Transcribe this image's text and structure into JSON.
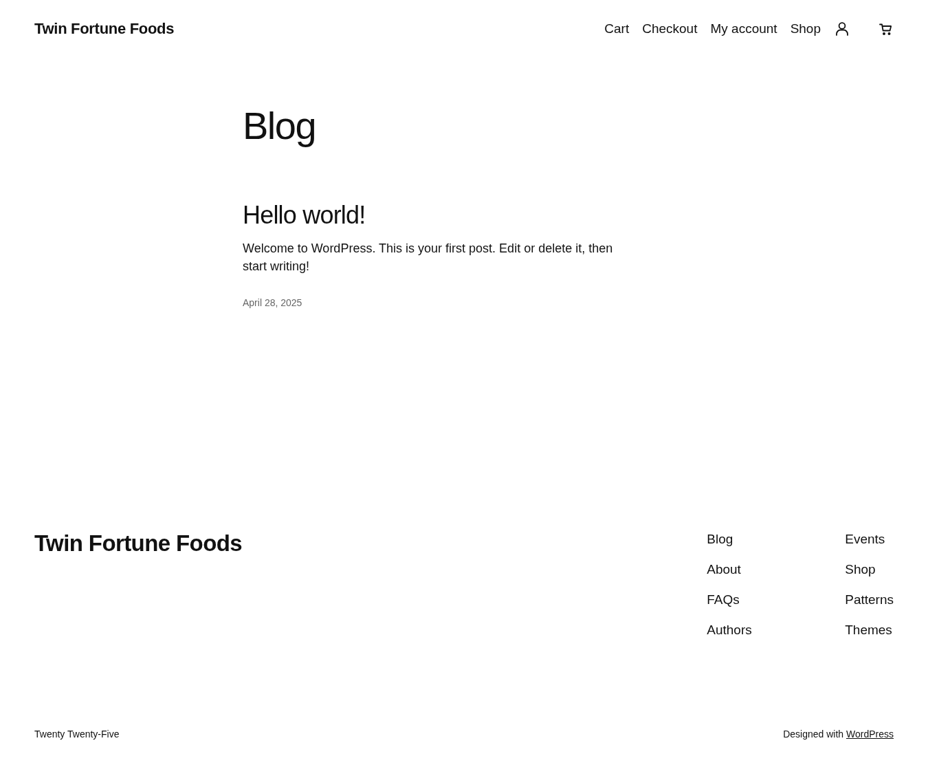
{
  "header": {
    "site_title": "Twin Fortune Foods",
    "nav": [
      {
        "label": "Cart"
      },
      {
        "label": "Checkout"
      },
      {
        "label": "My account"
      },
      {
        "label": "Shop"
      }
    ]
  },
  "page_title": "Blog",
  "posts": [
    {
      "title": "Hello world!",
      "excerpt": "Welcome to WordPress. This is your first post. Edit or delete it, then start writing!",
      "date": "April 28, 2025"
    }
  ],
  "footer": {
    "site_title": "Twin Fortune Foods",
    "nav_columns": [
      {
        "links": [
          "Blog",
          "About",
          "FAQs",
          "Authors"
        ]
      },
      {
        "links": [
          "Events",
          "Shop",
          "Patterns",
          "Themes"
        ]
      }
    ],
    "theme_name": "Twenty Twenty-Five",
    "credit": {
      "text": "Designed with",
      "link": "WordPress"
    }
  }
}
